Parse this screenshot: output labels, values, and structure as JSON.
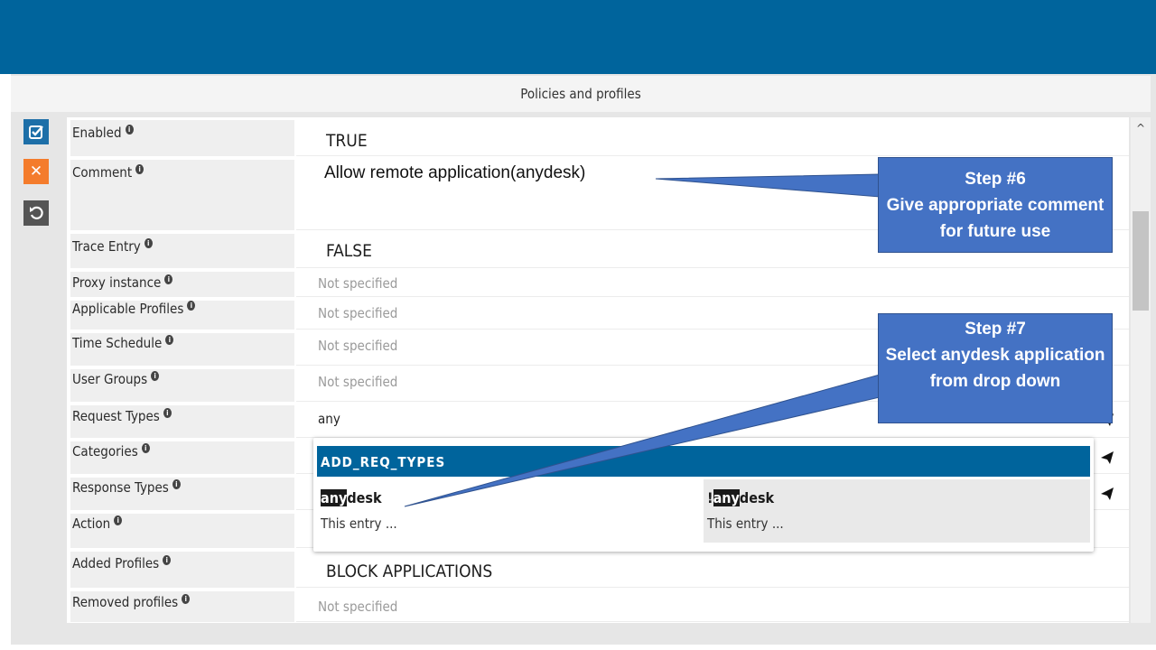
{
  "header": {
    "title": "Policies and profiles"
  },
  "toolbar": {
    "apply": "apply",
    "cancel": "cancel",
    "reset": "reset"
  },
  "fields": [
    {
      "key": "enabled",
      "label": "Enabled",
      "value": "TRUE",
      "style": "big"
    },
    {
      "key": "comment",
      "label": "Comment",
      "value": "Allow remote application(anydesk)",
      "style": "comment"
    },
    {
      "key": "trace_entry",
      "label": "Trace Entry",
      "value": "FALSE",
      "style": "big"
    },
    {
      "key": "proxy_instance",
      "label": "Proxy instance",
      "value": "Not specified",
      "style": "ns"
    },
    {
      "key": "applicable_profiles",
      "label": "Applicable Profiles",
      "value": "Not specified",
      "style": "ns"
    },
    {
      "key": "time_schedule",
      "label": "Time Schedule",
      "value": "Not specified",
      "style": "ns"
    },
    {
      "key": "user_groups",
      "label": "User Groups",
      "value": "Not specified",
      "style": "ns"
    },
    {
      "key": "request_types",
      "label": "Request Types",
      "value": "any",
      "style": "any"
    },
    {
      "key": "categories",
      "label": "Categories",
      "value": "",
      "style": "ns"
    },
    {
      "key": "response_types",
      "label": "Response Types",
      "value": "",
      "style": "ns"
    },
    {
      "key": "action",
      "label": "Action",
      "value": "",
      "style": "ns"
    },
    {
      "key": "added_profiles",
      "label": "Added Profiles",
      "value": "BLOCK APPLICATIONS",
      "style": "big"
    },
    {
      "key": "removed_profiles",
      "label": "Removed profiles",
      "value": "Not specified",
      "style": "ns"
    }
  ],
  "dropdown": {
    "header": "ADD_REQ_TYPES",
    "items": [
      {
        "prefix": "",
        "match": "any",
        "rest": "desk",
        "desc": "This entry ..."
      },
      {
        "prefix": "!",
        "match": "any",
        "rest": "desk",
        "desc": "This entry ..."
      }
    ]
  },
  "callouts": {
    "step6": {
      "title": "Step #6",
      "text": "Give appropriate comment for future use"
    },
    "step7": {
      "title": "Step #7",
      "text": "Select anydesk application from drop down"
    }
  },
  "colors": {
    "header": "#00649c",
    "callout": "#4472c4",
    "apply": "#1d6fa8",
    "cancel": "#f47c2c",
    "reset": "#555555"
  }
}
